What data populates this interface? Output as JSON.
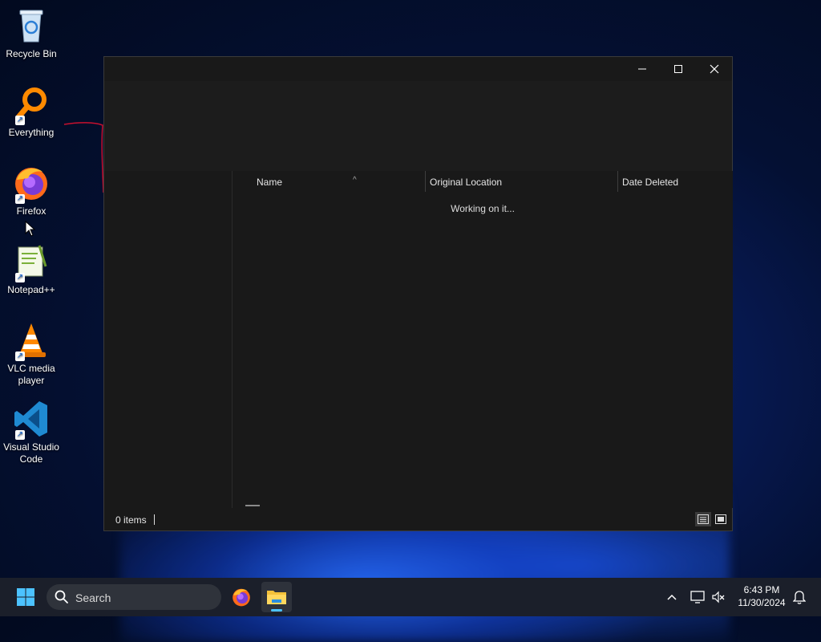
{
  "desktop": {
    "icons": [
      {
        "label": "Recycle Bin"
      },
      {
        "label": "Everything"
      },
      {
        "label": "Firefox"
      },
      {
        "label": "Notepad++"
      },
      {
        "label": "VLC media player"
      },
      {
        "label": "Visual Studio Code"
      }
    ]
  },
  "window": {
    "columns": [
      "Name",
      "Original Location",
      "Date Deleted"
    ],
    "loading_text": "Working on it...",
    "status": {
      "item_count": "0 items"
    }
  },
  "taskbar": {
    "search_placeholder": "Search",
    "clock": {
      "time": "6:43 PM",
      "date": "11/30/2024"
    }
  },
  "colors": {
    "accent": "#4cc2ff",
    "window_bg": "#191919",
    "annotation": "#c8102e"
  }
}
